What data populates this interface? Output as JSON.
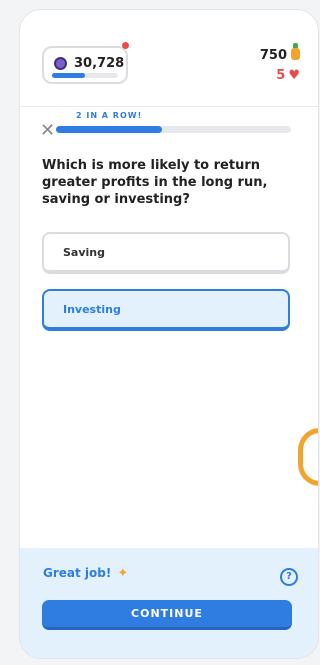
{
  "header": {
    "gems": "30,728",
    "gem_progress": 0.5,
    "points": "750",
    "lives": "5",
    "icons": [
      "gem-icon",
      "pineapple-icon",
      "heart-icon"
    ]
  },
  "lesson": {
    "streak_label": "2 IN A ROW!",
    "progress": 0.45,
    "question": "Which is more likely to return greater profits in the long run, saving or investing?",
    "options": [
      {
        "label": "Saving",
        "selected": false
      },
      {
        "label": "Investing",
        "selected": true
      }
    ]
  },
  "feedback": {
    "message": "Great job!",
    "continue_label": "CONTINUE"
  },
  "colors": {
    "accent": "#2f7de1",
    "danger": "#e54c4c",
    "feedback_bg": "#e3f1fd"
  }
}
